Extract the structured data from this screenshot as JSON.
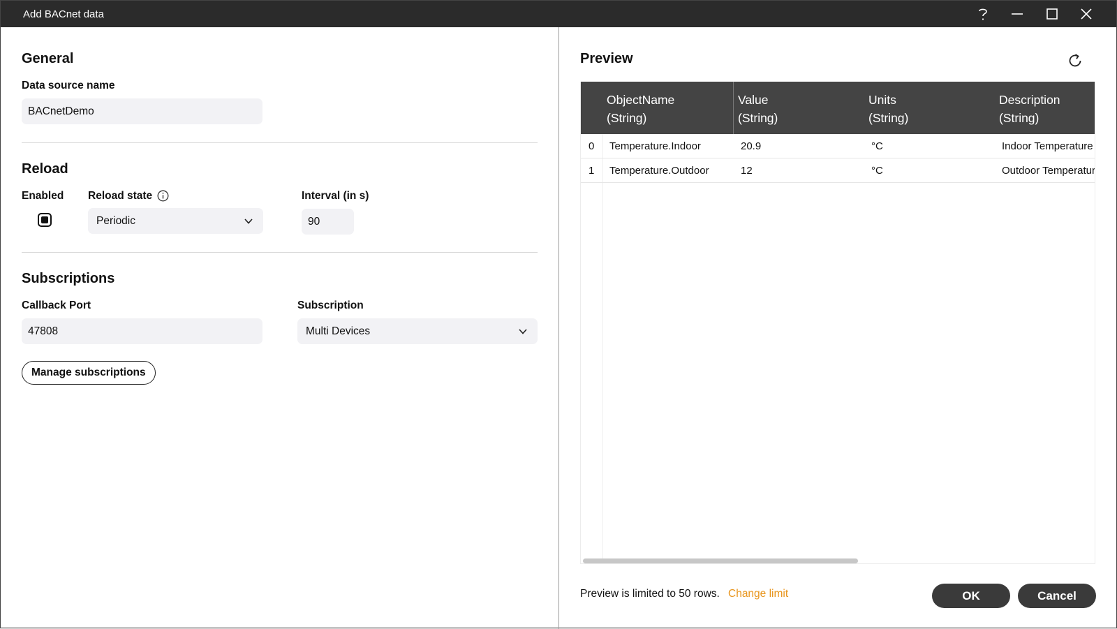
{
  "window": {
    "title": "Add BACnet data"
  },
  "general": {
    "heading": "General",
    "data_source_label": "Data source name",
    "data_source_value": "BACnetDemo"
  },
  "reload": {
    "heading": "Reload",
    "enabled_label": "Enabled",
    "enabled_checked": true,
    "state_label": "Reload state",
    "state_value": "Periodic",
    "interval_label": "Interval (in s)",
    "interval_value": "90"
  },
  "subscriptions": {
    "heading": "Subscriptions",
    "callback_label": "Callback Port",
    "callback_value": "47808",
    "subscription_label": "Subscription",
    "subscription_value": "Multi Devices",
    "manage_button": "Manage subscriptions"
  },
  "preview": {
    "heading": "Preview",
    "columns": [
      {
        "name": "ObjectName",
        "type": "(String)"
      },
      {
        "name": "Value",
        "type": "(String)"
      },
      {
        "name": "Units",
        "type": "(String)"
      },
      {
        "name": "Description",
        "type": "(String)"
      }
    ],
    "rows": [
      {
        "index": "0",
        "cells": [
          "Temperature.Indoor",
          "20.9",
          "°C",
          "Indoor Temperature"
        ]
      },
      {
        "index": "1",
        "cells": [
          "Temperature.Outdoor",
          "12",
          "°C",
          "Outdoor Temperature"
        ]
      }
    ],
    "limit_text": "Preview is limited to 50 rows.",
    "change_limit": "Change limit"
  },
  "buttons": {
    "ok": "OK",
    "cancel": "Cancel"
  },
  "colors": {
    "titlebar": "#2b2b2b",
    "header": "#444444",
    "accent": "#e8951c",
    "button": "#3a3a3a"
  }
}
